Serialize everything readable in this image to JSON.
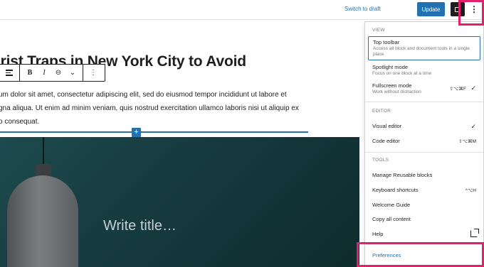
{
  "header": {
    "switch_to_draft": "Switch to draft",
    "update": "Update"
  },
  "editor": {
    "post_title": "urist Traps in New York City to Avoid",
    "paragraph_lines": [
      "um dolor sit amet, consectetur adipiscing elit, sed do eiusmod tempor incididunt ut labore et",
      "gna aliqua. Ut enim ad minim veniam, quis nostrud exercitation ullamco laboris nisi ut aliquip ex",
      "o consequat."
    ],
    "inserter": "+",
    "cover_placeholder": "Write title…"
  },
  "block_toolbar": {
    "bold": "B",
    "italic": "I",
    "link": "⊖",
    "more": "⌄",
    "options": "⋮"
  },
  "options_menu": {
    "view": {
      "heading": "VIEW",
      "top_toolbar": {
        "label": "Top toolbar",
        "desc": "Access all block and document tools in a single place"
      },
      "spotlight": {
        "label": "Spotlight mode",
        "desc": "Focus on one block at a time"
      },
      "fullscreen": {
        "label": "Fullscreen mode",
        "desc": "Work without distraction",
        "shortcut": "⇧⌥⌘F",
        "check": "✓"
      }
    },
    "editor": {
      "heading": "EDITOR",
      "visual": {
        "label": "Visual editor",
        "check": "✓"
      },
      "code": {
        "label": "Code editor",
        "shortcut": "⇧⌥⌘M"
      }
    },
    "tools": {
      "heading": "TOOLS",
      "reusable": "Manage Reusable blocks",
      "shortcuts": {
        "label": "Keyboard shortcuts",
        "shortcut": "^⌥H"
      },
      "welcome": "Welcome Guide",
      "copy": "Copy all content",
      "help": "Help"
    },
    "preferences": "Preferences"
  },
  "colors": {
    "accent": "#2271b1",
    "highlight": "#e41f6b",
    "cover_bg": "#163c40"
  },
  "icons": {
    "settings": "settings-panel-icon",
    "options": "vertical-ellipsis-icon",
    "align": "align-left-icon",
    "external": "external-link-icon"
  }
}
